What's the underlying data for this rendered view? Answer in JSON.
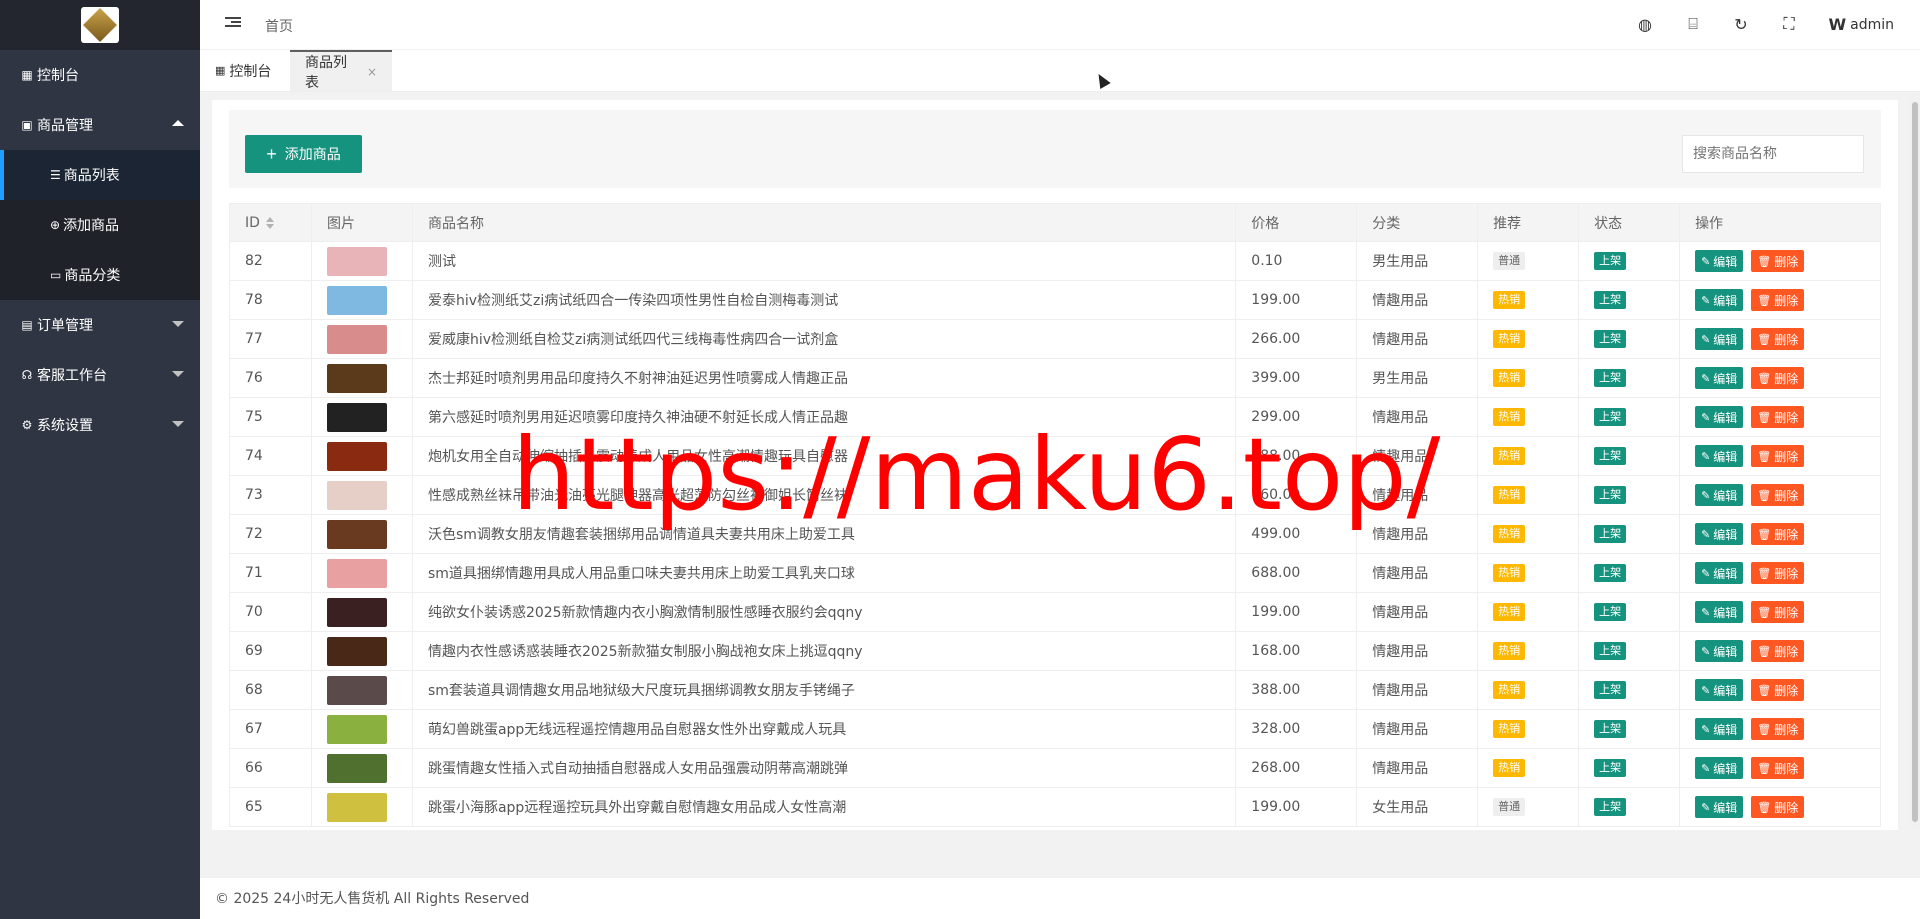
{
  "sidebar": {
    "items": [
      {
        "label": "控制台",
        "icon": "dashboard-icon"
      },
      {
        "label": "商品管理",
        "icon": "product-icon",
        "expanded": true,
        "children": [
          {
            "label": "商品列表",
            "icon": "list-icon",
            "active": true
          },
          {
            "label": "添加商品",
            "icon": "add-circle-icon"
          },
          {
            "label": "商品分类",
            "icon": "folder-icon"
          }
        ]
      },
      {
        "label": "订单管理",
        "icon": "order-icon"
      },
      {
        "label": "客服工作台",
        "icon": "headset-icon"
      },
      {
        "label": "系统设置",
        "icon": "gear-icon"
      }
    ]
  },
  "header": {
    "breadcrumb": "首页",
    "user": "admin"
  },
  "tabs": [
    {
      "label": "控制台"
    },
    {
      "label": "商品列表",
      "close": "×"
    }
  ],
  "toolbar": {
    "add_label": "添加商品",
    "search_placeholder": "搜索商品名称"
  },
  "table": {
    "headers": [
      "ID",
      "图片",
      "商品名称",
      "价格",
      "分类",
      "推荐",
      "状态",
      "操作"
    ],
    "edit_label": "编辑",
    "delete_label": "删除",
    "rows": [
      {
        "id": "82",
        "name": "测试",
        "price": "0.10",
        "category": "男生用品",
        "rec": "普通",
        "status": "上架",
        "thumb": "#e8b4b8"
      },
      {
        "id": "78",
        "name": "爱泰hiv检测纸艾zi病试纸四合一传染四项性男性自检自测梅毒测试",
        "price": "199.00",
        "category": "情趣用品",
        "rec": "热销",
        "status": "上架",
        "thumb": "#7fb8e0"
      },
      {
        "id": "77",
        "name": "爱威康hiv检测纸自检艾zi病测试纸四代三线梅毒性病四合一试剂盒",
        "price": "266.00",
        "category": "情趣用品",
        "rec": "热销",
        "status": "上架",
        "thumb": "#d98c8c"
      },
      {
        "id": "76",
        "name": "杰士邦延时喷剂男用品印度持久不射神油延迟男性喷雾成人情趣正品",
        "price": "399.00",
        "category": "男生用品",
        "rec": "热销",
        "status": "上架",
        "thumb": "#5a3a1a"
      },
      {
        "id": "75",
        "name": "第六感延时喷剂男用延迟喷雾印度持久神油硬不射延长成人情正品趣",
        "price": "299.00",
        "category": "情趣用品",
        "rec": "热销",
        "status": "上架",
        "thumb": "#222222"
      },
      {
        "id": "74",
        "name": "炮机女用全自动伸缩抽插入震动棒成人用品女性高潮情趣玩具自慰器",
        "price": "388.00",
        "category": "情趣用品",
        "rec": "热销",
        "status": "上架",
        "thumb": "#8a2a10"
      },
      {
        "id": "73",
        "name": "性感成熟丝袜吊带油光油亮光腿神器高光超薄防勾丝袜御姐长筒丝袜",
        "price": "160.00",
        "category": "情趣用品",
        "rec": "热销",
        "status": "上架",
        "thumb": "#e6cfc6"
      },
      {
        "id": "72",
        "name": "沃色sm调教女朋友情趣套装捆绑用品调情道具夫妻共用床上助爱工具",
        "price": "499.00",
        "category": "情趣用品",
        "rec": "热销",
        "status": "上架",
        "thumb": "#6a3a20"
      },
      {
        "id": "71",
        "name": "sm道具捆绑情趣用具成人用品重口味夫妻共用床上助爱工具乳夹口球",
        "price": "688.00",
        "category": "情趣用品",
        "rec": "热销",
        "status": "上架",
        "thumb": "#e8a0a0"
      },
      {
        "id": "70",
        "name": "纯欲女仆装诱惑2025新款情趣内衣小胸激情制服性感睡衣服约会qqny",
        "price": "199.00",
        "category": "情趣用品",
        "rec": "热销",
        "status": "上架",
        "thumb": "#3a2020"
      },
      {
        "id": "69",
        "name": "情趣内衣性感诱惑装睡衣2025新款猫女制服小胸战袍女床上挑逗qqny",
        "price": "168.00",
        "category": "情趣用品",
        "rec": "热销",
        "status": "上架",
        "thumb": "#4a2818"
      },
      {
        "id": "68",
        "name": "sm套装道具调情趣女用品地狱级大尺度玩具捆绑调教女朋友手铐绳子",
        "price": "388.00",
        "category": "情趣用品",
        "rec": "热销",
        "status": "上架",
        "thumb": "#5a4a4a"
      },
      {
        "id": "67",
        "name": "萌幻兽跳蛋app无线远程遥控情趣用品自慰器女性外出穿戴成人玩具",
        "price": "328.00",
        "category": "情趣用品",
        "rec": "热销",
        "status": "上架",
        "thumb": "#8ab040"
      },
      {
        "id": "66",
        "name": "跳蛋情趣女性插入式自动抽插自慰器成人女用品强震动阴蒂高潮跳弹",
        "price": "268.00",
        "category": "情趣用品",
        "rec": "热销",
        "status": "上架",
        "thumb": "#507030"
      },
      {
        "id": "65",
        "name": "跳蛋小海豚app远程遥控玩具外出穿戴自慰情趣女用品成人女性高潮",
        "price": "199.00",
        "category": "女生用品",
        "rec": "普通",
        "status": "上架",
        "thumb": "#d0c040"
      }
    ]
  },
  "footer": "© 2025 24小时无人售货机 All Rights Reserved",
  "watermark": "https://maku6.top/",
  "colors": {
    "sidebar": "#2f3542",
    "accent": "#16937e",
    "hot": "#ffb800",
    "danger": "#ff5722"
  }
}
